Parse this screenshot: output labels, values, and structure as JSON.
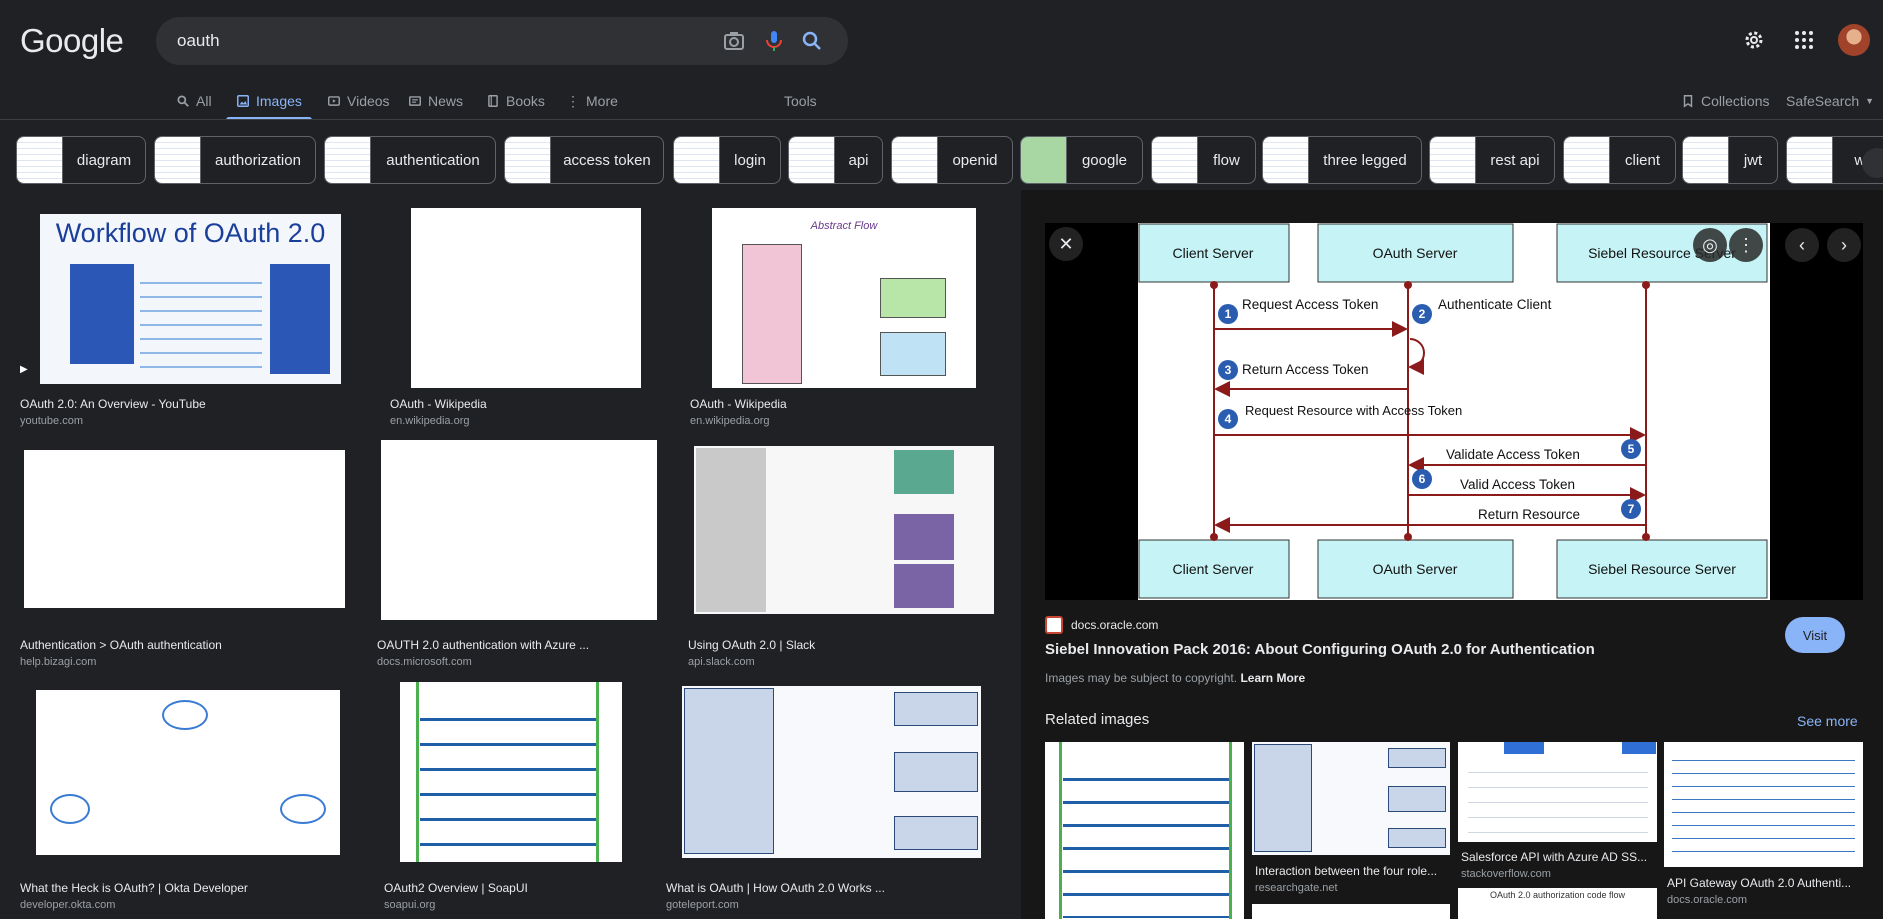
{
  "header": {
    "logo": "Google",
    "query": "oauth"
  },
  "tabs": [
    {
      "label": "All"
    },
    {
      "label": "Images"
    },
    {
      "label": "Videos"
    },
    {
      "label": "News"
    },
    {
      "label": "Books"
    },
    {
      "label": "More"
    },
    {
      "label": "Tools"
    }
  ],
  "right_tools": {
    "collections": "Collections",
    "safesearch": "SafeSearch"
  },
  "chips": [
    "diagram",
    "authorization",
    "authentication",
    "access token",
    "login",
    "api",
    "openid",
    "google",
    "flow",
    "three legged",
    "rest api",
    "client",
    "jwt",
    "wo"
  ],
  "results": [
    {
      "title": "OAuth 2.0: An Overview - YouTube",
      "source": "youtube.com",
      "headline": "Workflow of OAuth 2.0"
    },
    {
      "title": "OAuth - Wikipedia",
      "source": "en.wikipedia.org"
    },
    {
      "title": "OAuth - Wikipedia",
      "source": "en.wikipedia.org",
      "headline": "Abstract Flow"
    },
    {
      "title": "Authentication > OAuth authentication",
      "source": "help.bizagi.com"
    },
    {
      "title": "OAUTH 2.0 authentication with Azure ...",
      "source": "docs.microsoft.com"
    },
    {
      "title": "Using OAuth 2.0 | Slack",
      "source": "api.slack.com"
    },
    {
      "title": "What the Heck is OAuth? | Okta Developer",
      "source": "developer.okta.com"
    },
    {
      "title": "OAuth2 Overview | SoapUI",
      "source": "soapui.org"
    },
    {
      "title": "What is OAuth | How OAuth 2.0 Works ...",
      "source": "goteleport.com"
    }
  ],
  "preview": {
    "boxes": {
      "client": "Client Server",
      "oauth": "OAuth Server",
      "siebel": "Siebel Resource Server"
    },
    "steps": [
      {
        "n": "1",
        "text": "Request Access Token"
      },
      {
        "n": "2",
        "text": "Authenticate Client"
      },
      {
        "n": "3",
        "text": "Return Access Token"
      },
      {
        "n": "4",
        "text": "Request Resource with Access Token"
      },
      {
        "n": "5",
        "text": "Validate Access Token"
      },
      {
        "n": "6",
        "text": "Valid Access Token"
      },
      {
        "n": "7",
        "text": "Return Resource"
      }
    ],
    "site": "docs.oracle.com",
    "title": "Siebel Innovation Pack 2016: About Configuring OAuth 2.0 for Authentication",
    "copyright": "Images may be subject to copyright.",
    "learn_more": "Learn More",
    "visit": "Visit",
    "related_heading": "Related images",
    "see_more": "See more"
  },
  "related": [
    {
      "title": "",
      "source": ""
    },
    {
      "title": "Interaction between the four role...",
      "source": "researchgate.net"
    },
    {
      "title": "Salesforce API with Azure AD SS...",
      "source": "stackoverflow.com",
      "caption": "OAuth 2.0 authorization code flow"
    },
    {
      "title": "API Gateway OAuth 2.0 Authenti...",
      "source": "docs.oracle.com"
    }
  ],
  "colors": {
    "accent": "#8ab4f8",
    "bg": "#202124",
    "panel": "#171717",
    "box": "#c6f3f5",
    "arrow": "#8b1a1a",
    "step": "#2a5db0"
  }
}
